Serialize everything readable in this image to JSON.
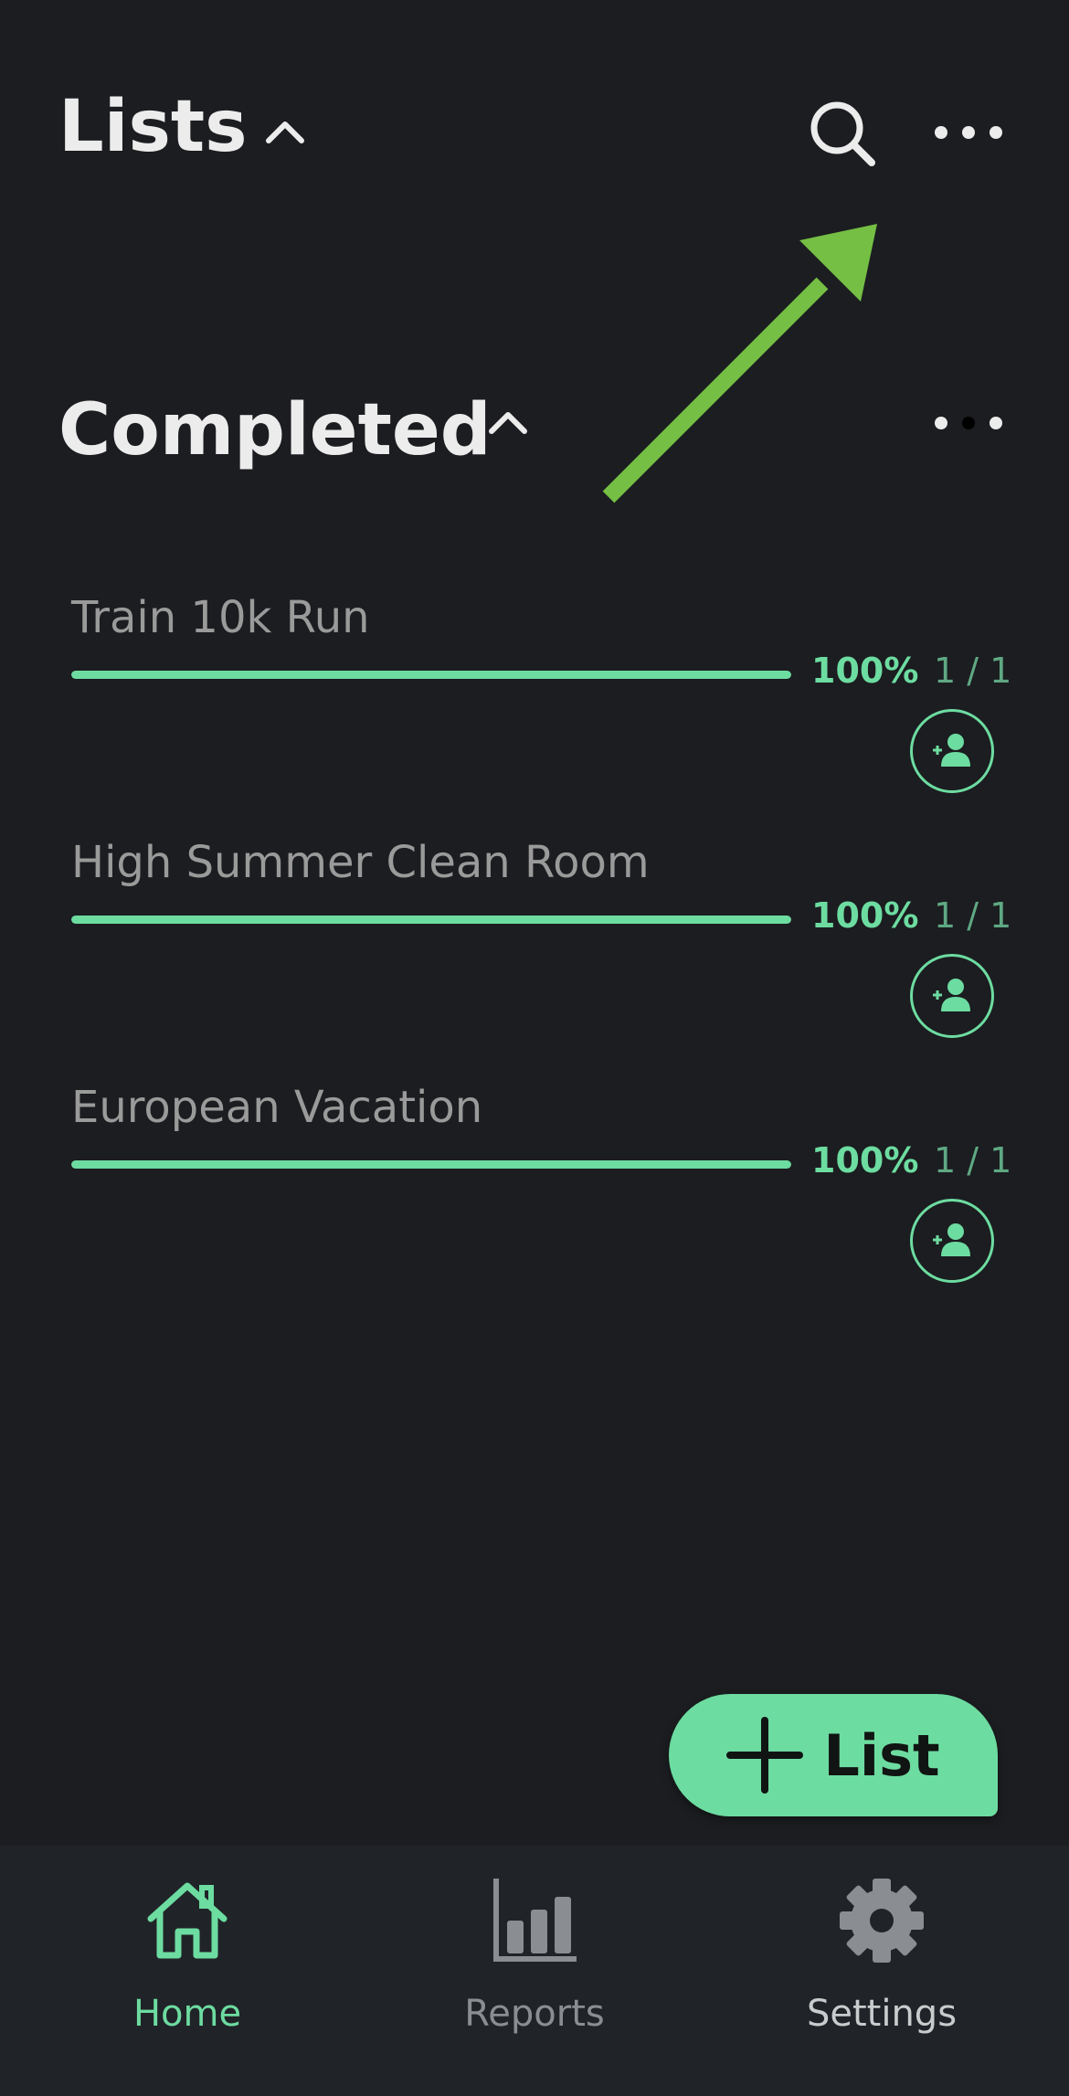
{
  "colors": {
    "background": "#1b1d20",
    "accent": "#6ddca1",
    "nav_background": "#202428",
    "arrow": "#74bf44",
    "muted_text": "#9a9a9a"
  },
  "header": {
    "title": "Lists",
    "collapse_icon": "chevron-up-icon",
    "search_icon": "search-icon",
    "more_icon": "more-horizontal-icon"
  },
  "section": {
    "title": "Completed",
    "collapse_icon": "chevron-up-icon",
    "more_icon": "more-horizontal-icon"
  },
  "lists": [
    {
      "name": "Train 10k Run",
      "progress": 1.0,
      "percent": "100%",
      "count": "1 / 1",
      "share_icon": "add-user-icon"
    },
    {
      "name": "High Summer Clean Room",
      "progress": 1.0,
      "percent": "100%",
      "count": "1 / 1",
      "share_icon": "add-user-icon"
    },
    {
      "name": "European Vacation",
      "progress": 1.0,
      "percent": "100%",
      "count": "1 / 1",
      "share_icon": "add-user-icon"
    }
  ],
  "fab": {
    "label": "List",
    "icon": "plus-icon"
  },
  "bottom_nav": [
    {
      "label": "Home",
      "icon": "home-icon",
      "active": true
    },
    {
      "label": "Reports",
      "icon": "bar-chart-icon",
      "active": false
    },
    {
      "label": "Settings",
      "icon": "gear-icon",
      "active": false
    }
  ]
}
